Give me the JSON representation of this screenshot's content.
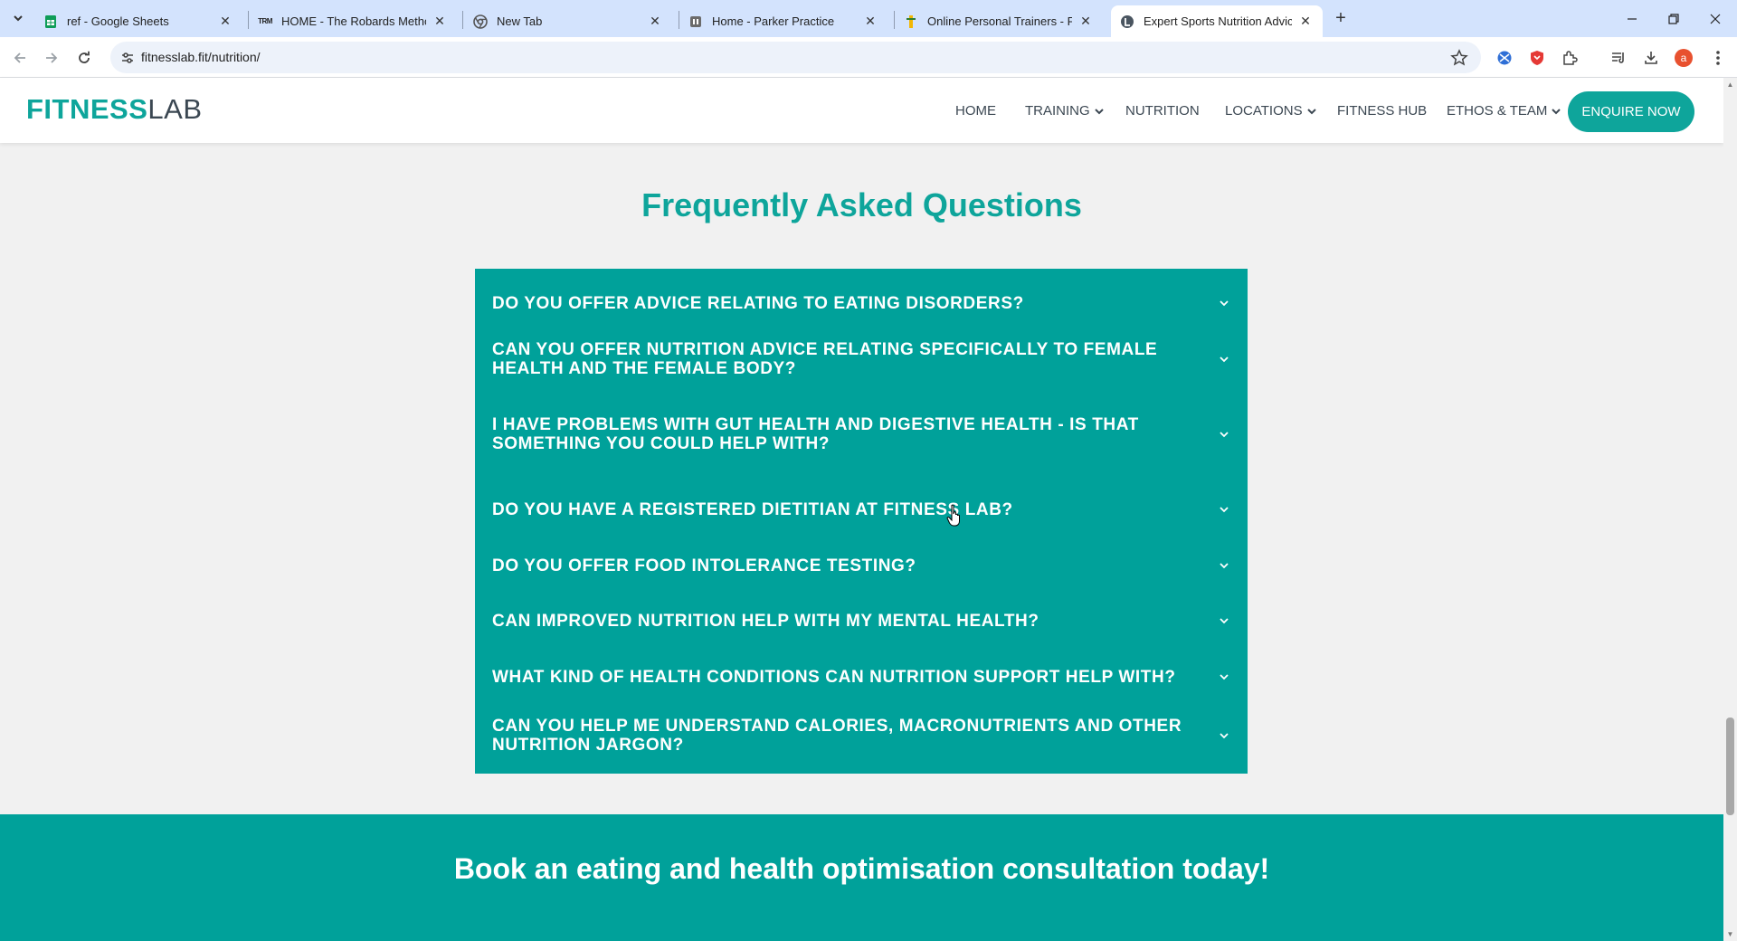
{
  "browser": {
    "tabs": [
      {
        "title": "ref - Google Sheets",
        "icon": "sheets-icon"
      },
      {
        "title": "HOME - The Robards Method",
        "icon": "trm-icon"
      },
      {
        "title": "New Tab",
        "icon": "chrome-icon"
      },
      {
        "title": "Home - Parker Practice",
        "icon": "pp-icon"
      },
      {
        "title": "Online Personal Trainers - Fitness",
        "icon": "trainer-icon"
      },
      {
        "title": "Expert Sports Nutrition Advice | Fitness Lab",
        "icon": "fitnesslab-icon"
      }
    ],
    "trm_badge": "TRM",
    "url": "fitnesslab.fit/nutrition/",
    "profile_initial": "a"
  },
  "site": {
    "logo_strong": "FITNESS",
    "logo_light": "LAB",
    "nav": {
      "home": "HOME",
      "training": "TRAINING",
      "nutrition": "NUTRITION",
      "locations": "LOCATIONS",
      "fitness_hub": "FITNESS HUB",
      "ethos": "ETHOS & TEAM",
      "enquire": "ENQUIRE NOW"
    },
    "faq_title": "Frequently Asked Questions",
    "faqs": [
      "DO YOU OFFER ADVICE RELATING TO EATING DISORDERS?",
      "CAN YOU OFFER NUTRITION ADVICE RELATING SPECIFICALLY TO FEMALE HEALTH AND THE FEMALE BODY?",
      "I HAVE PROBLEMS WITH GUT HEALTH AND DIGESTIVE HEALTH - IS THAT SOMETHING YOU COULD HELP WITH?",
      "DO YOU HAVE A REGISTERED DIETITIAN AT FITNESS LAB?",
      "DO YOU OFFER FOOD INTOLERANCE TESTING?",
      "CAN IMPROVED NUTRITION HELP WITH MY MENTAL HEALTH?",
      "WHAT KIND OF HEALTH CONDITIONS CAN NUTRITION SUPPORT HELP WITH?",
      "CAN YOU HELP ME UNDERSTAND CALORIES, MACRONUTRIENTS AND OTHER NUTRITION JARGON?"
    ],
    "cta_heading": "Book an eating and health optimisation consultation today!"
  },
  "colors": {
    "brand": "#0ea59b",
    "faq_bg": "#00a19a",
    "page_bg": "#f1f1f1",
    "tabstrip": "#d3e3fd"
  }
}
